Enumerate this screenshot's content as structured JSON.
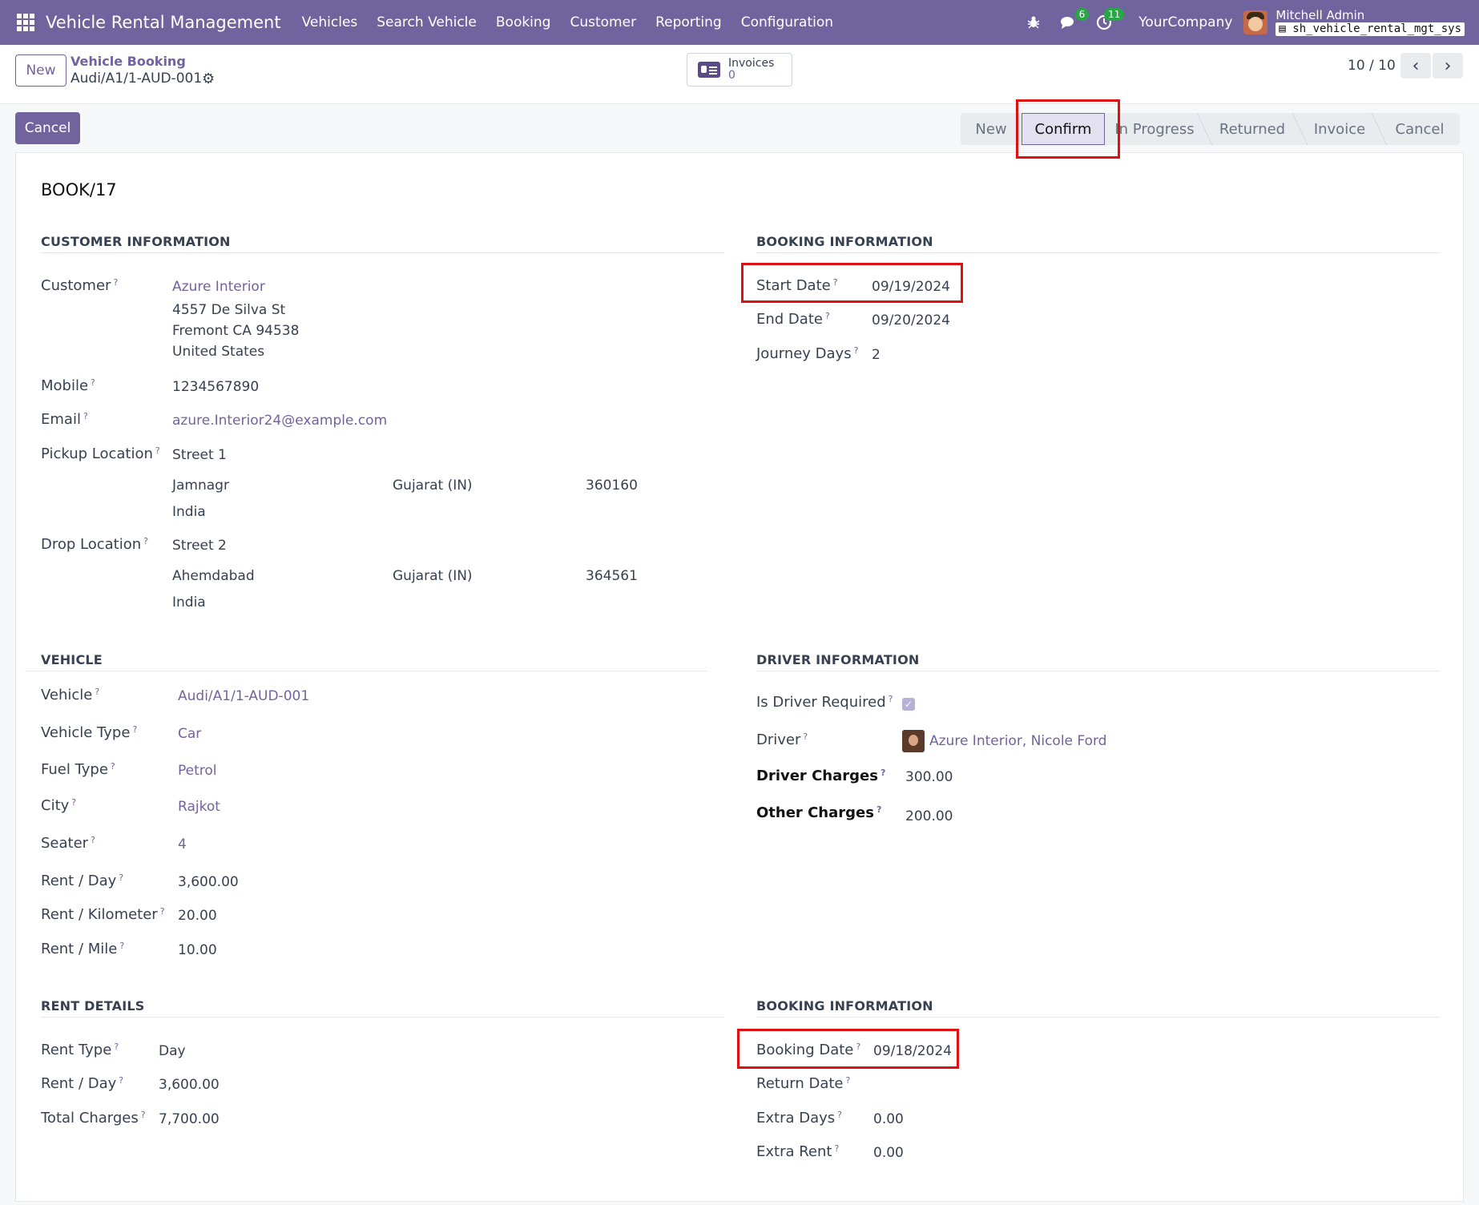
{
  "navbar": {
    "app_title": "Vehicle Rental Management",
    "menu": [
      "Vehicles",
      "Search Vehicle",
      "Booking",
      "Customer",
      "Reporting",
      "Configuration"
    ],
    "messages_count": "6",
    "activities_count": "11",
    "company": "YourCompany",
    "user_name": "Mitchell Admin",
    "database": "sh_vehicle_rental_mgt_sys"
  },
  "control": {
    "new_label": "New",
    "breadcrumb_parent": "Vehicle Booking",
    "breadcrumb_record": "Audi/A1/1-AUD-001",
    "invoices_label": "Invoices",
    "invoices_count": "0",
    "pager": "10 / 10"
  },
  "status": {
    "cancel_label": "Cancel",
    "stages": [
      "New",
      "Confirm",
      "In Progress",
      "Returned",
      "Invoice",
      "Cancel"
    ],
    "current_stage": "Confirm"
  },
  "record": {
    "name": "BOOK/17",
    "customer_section": {
      "title": "CUSTOMER INFORMATION",
      "customer_label": "Customer",
      "customer_name": "Azure Interior",
      "address_line1": "4557 De Silva St",
      "address_line2": "Fremont CA 94538",
      "address_line3": "United States",
      "mobile_label": "Mobile",
      "mobile": "1234567890",
      "email_label": "Email",
      "email": "azure.Interior24@example.com",
      "pickup_label": "Pickup Location",
      "pickup_street": "Street 1",
      "pickup_city": "Jamnagr",
      "pickup_state": "Gujarat (IN)",
      "pickup_zip": "360160",
      "pickup_country": "India",
      "drop_label": "Drop Location",
      "drop_street": "Street 2",
      "drop_city": "Ahemdabad",
      "drop_state": "Gujarat (IN)",
      "drop_zip": "364561",
      "drop_country": "India"
    },
    "booking_section": {
      "title": "BOOKING INFORMATION",
      "start_label": "Start Date",
      "start_date": "09/19/2024",
      "end_label": "End Date",
      "end_date": "09/20/2024",
      "days_label": "Journey Days",
      "journey_days": "2"
    },
    "vehicle_section": {
      "title": "VEHICLE",
      "vehicle_label": "Vehicle",
      "vehicle": "Audi/A1/1-AUD-001",
      "type_label": "Vehicle Type",
      "vehicle_type": "Car",
      "fuel_label": "Fuel Type",
      "fuel_type": "Petrol",
      "city_label": "City",
      "city": "Rajkot",
      "seater_label": "Seater",
      "seater": "4",
      "rent_day_label": "Rent / Day",
      "rent_day": "3,600.00",
      "rent_km_label": "Rent / Kilometer",
      "rent_km": "20.00",
      "rent_mile_label": "Rent / Mile",
      "rent_mile": "10.00"
    },
    "driver_section": {
      "title": "DRIVER INFORMATION",
      "required_label": "Is Driver Required",
      "driver_label": "Driver",
      "driver": "Azure Interior, Nicole Ford",
      "charges_label": "Driver Charges",
      "driver_charges": "300.00",
      "other_label": "Other Charges",
      "other_charges": "200.00"
    },
    "rent_section": {
      "title": "RENT DETAILS",
      "type_label": "Rent Type",
      "rent_type": "Day",
      "rent_day_label": "Rent / Day",
      "rent_day": "3,600.00",
      "total_label": "Total Charges",
      "total_charges": "7,700.00"
    },
    "booking_section2": {
      "title": "BOOKING INFORMATION",
      "booking_label": "Booking Date",
      "booking_date": "09/18/2024",
      "return_label": "Return Date",
      "extra_days_label": "Extra Days",
      "extra_days": "0.00",
      "extra_rent_label": "Extra Rent",
      "extra_rent": "0.00"
    }
  }
}
